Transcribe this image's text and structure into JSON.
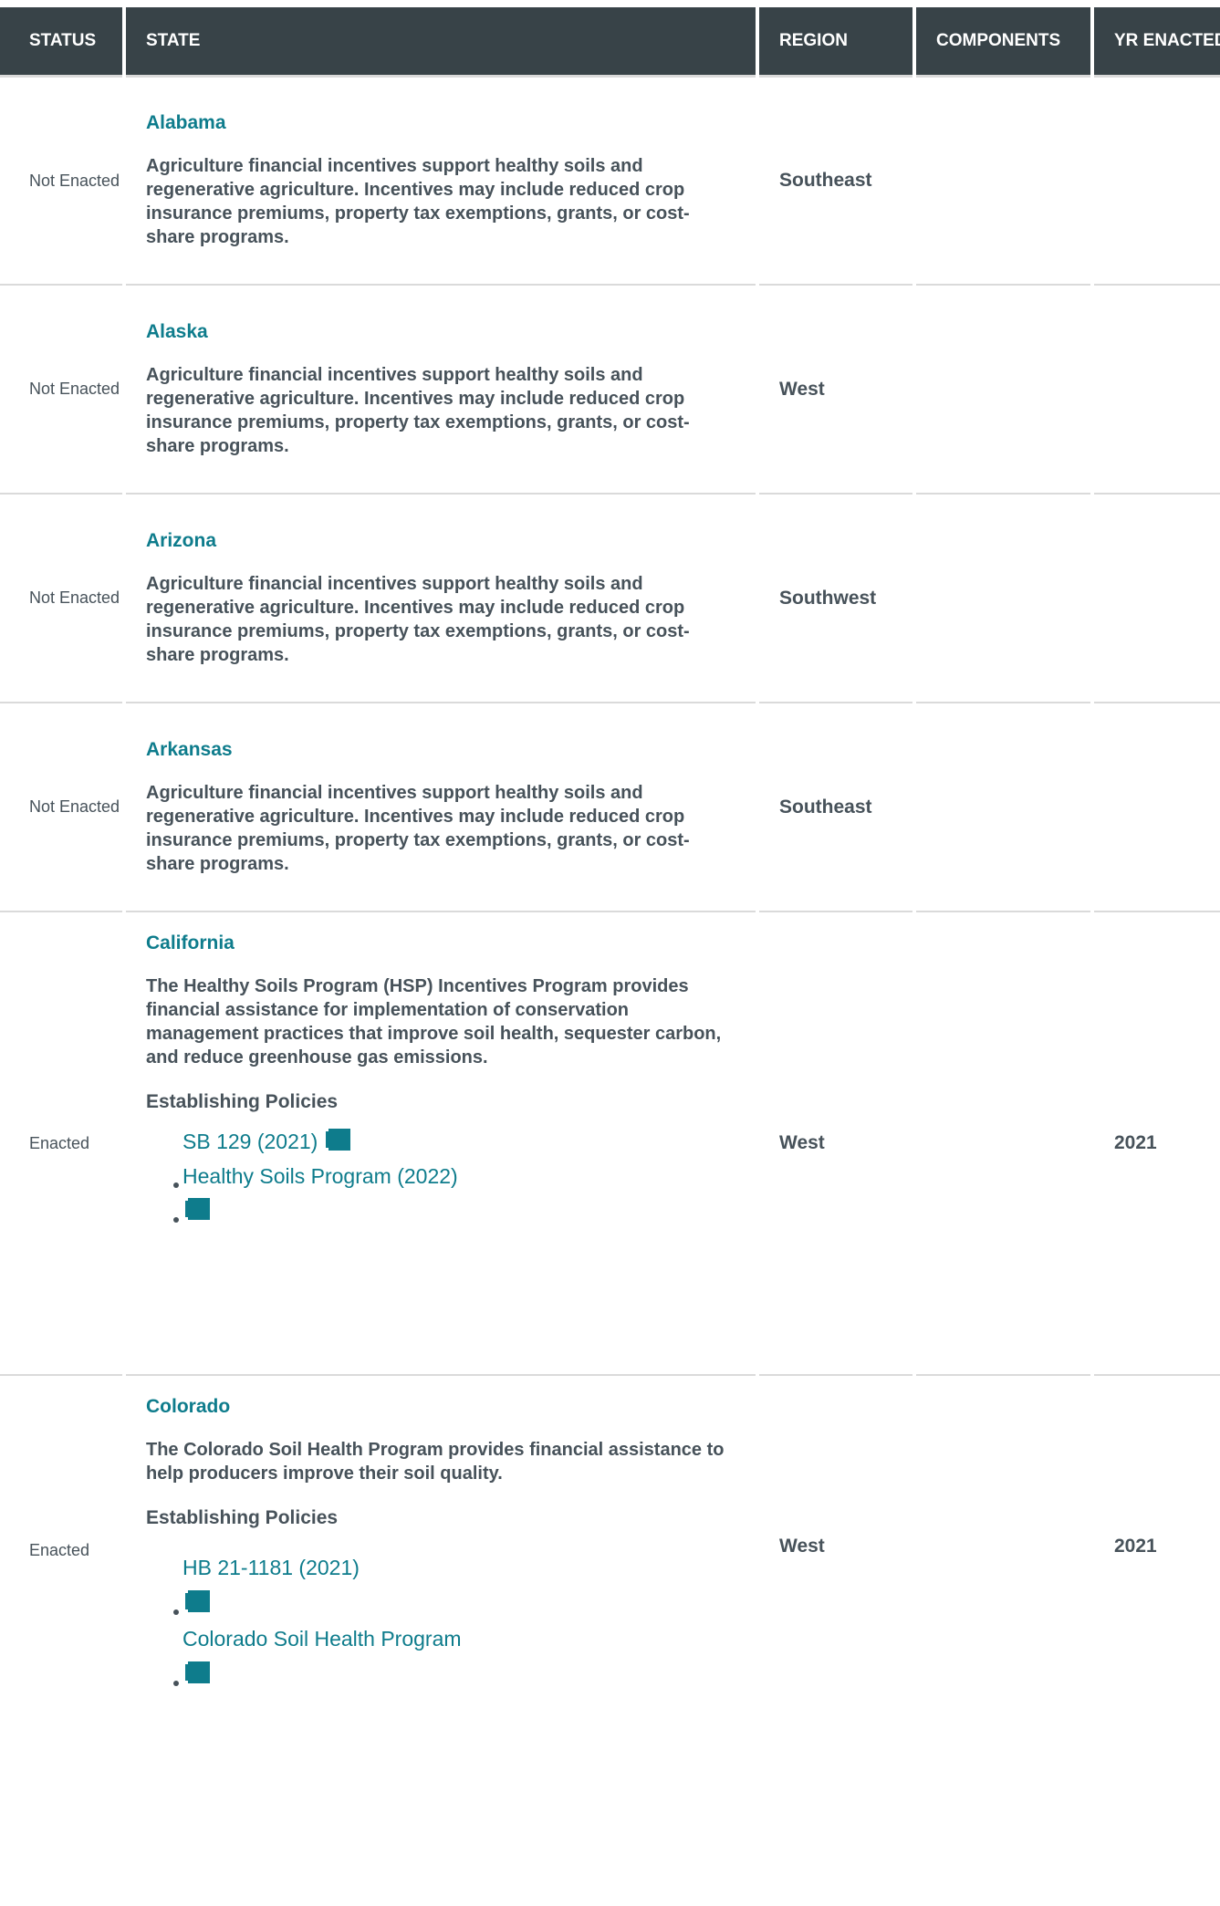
{
  "table": {
    "headers": {
      "status": "STATUS",
      "state": "STATE",
      "region": "REGION",
      "components": "COMPONENTS",
      "year": "YR ENACTED"
    },
    "rows": [
      {
        "status": "Not Enacted",
        "state": "Alabama",
        "description": "Agriculture financial incentives support healthy soils and regenerative agriculture. Incentives may include reduced crop insurance premiums, property tax exemptions, grants, or cost-share programs.",
        "region": "Southeast",
        "year": ""
      },
      {
        "status": "Not Enacted",
        "state": "Alaska",
        "description": "Agriculture financial incentives support healthy soils and regenerative agriculture. Incentives may include reduced crop insurance premiums, property tax exemptions, grants, or cost-share programs.",
        "region": "West",
        "year": ""
      },
      {
        "status": "Not Enacted",
        "state": "Arizona",
        "description": "Agriculture financial incentives support healthy soils and regenerative agriculture. Incentives may include reduced crop insurance premiums, property tax exemptions, grants, or cost-share programs.",
        "region": "Southwest",
        "year": ""
      },
      {
        "status": "Not Enacted",
        "state": "Arkansas",
        "description": "Agriculture financial incentives support healthy soils and regenerative agriculture. Incentives may include reduced crop insurance premiums, property tax exemptions, grants, or cost-share programs.",
        "region": "Southeast",
        "year": ""
      },
      {
        "status": "Enacted",
        "state": "California",
        "description": "The Healthy Soils Program (HSP) Incentives Program provides financial assistance for implementation of conservation management practices that improve soil health, sequester carbon, and reduce greenhouse gas emissions.",
        "policies_label": "Establishing Policies",
        "policies": [
          "SB 129 (2021)",
          "Healthy Soils Program (2022)"
        ],
        "region": "West",
        "year": "2021"
      },
      {
        "status": "Enacted",
        "state": "Colorado",
        "description": "The Colorado Soil Health Program provides financial assistance to help producers improve their soil quality.",
        "policies_label": "Establishing Policies",
        "policies": [
          "HB 21-1181 (2021)",
          "Colorado Soil Health Program"
        ],
        "region": "West",
        "year": "2021"
      }
    ]
  }
}
